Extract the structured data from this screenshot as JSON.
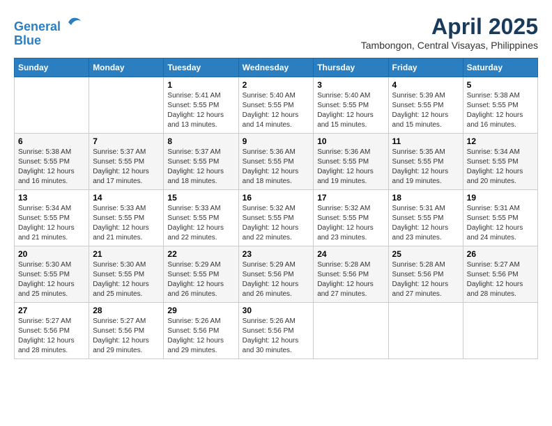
{
  "header": {
    "logo_line1": "General",
    "logo_line2": "Blue",
    "title": "April 2025",
    "subtitle": "Tambongon, Central Visayas, Philippines"
  },
  "weekdays": [
    "Sunday",
    "Monday",
    "Tuesday",
    "Wednesday",
    "Thursday",
    "Friday",
    "Saturday"
  ],
  "weeks": [
    [
      {
        "day": "",
        "info": ""
      },
      {
        "day": "",
        "info": ""
      },
      {
        "day": "1",
        "info": "Sunrise: 5:41 AM\nSunset: 5:55 PM\nDaylight: 12 hours\nand 13 minutes."
      },
      {
        "day": "2",
        "info": "Sunrise: 5:40 AM\nSunset: 5:55 PM\nDaylight: 12 hours\nand 14 minutes."
      },
      {
        "day": "3",
        "info": "Sunrise: 5:40 AM\nSunset: 5:55 PM\nDaylight: 12 hours\nand 15 minutes."
      },
      {
        "day": "4",
        "info": "Sunrise: 5:39 AM\nSunset: 5:55 PM\nDaylight: 12 hours\nand 15 minutes."
      },
      {
        "day": "5",
        "info": "Sunrise: 5:38 AM\nSunset: 5:55 PM\nDaylight: 12 hours\nand 16 minutes."
      }
    ],
    [
      {
        "day": "6",
        "info": "Sunrise: 5:38 AM\nSunset: 5:55 PM\nDaylight: 12 hours\nand 16 minutes."
      },
      {
        "day": "7",
        "info": "Sunrise: 5:37 AM\nSunset: 5:55 PM\nDaylight: 12 hours\nand 17 minutes."
      },
      {
        "day": "8",
        "info": "Sunrise: 5:37 AM\nSunset: 5:55 PM\nDaylight: 12 hours\nand 18 minutes."
      },
      {
        "day": "9",
        "info": "Sunrise: 5:36 AM\nSunset: 5:55 PM\nDaylight: 12 hours\nand 18 minutes."
      },
      {
        "day": "10",
        "info": "Sunrise: 5:36 AM\nSunset: 5:55 PM\nDaylight: 12 hours\nand 19 minutes."
      },
      {
        "day": "11",
        "info": "Sunrise: 5:35 AM\nSunset: 5:55 PM\nDaylight: 12 hours\nand 19 minutes."
      },
      {
        "day": "12",
        "info": "Sunrise: 5:34 AM\nSunset: 5:55 PM\nDaylight: 12 hours\nand 20 minutes."
      }
    ],
    [
      {
        "day": "13",
        "info": "Sunrise: 5:34 AM\nSunset: 5:55 PM\nDaylight: 12 hours\nand 21 minutes."
      },
      {
        "day": "14",
        "info": "Sunrise: 5:33 AM\nSunset: 5:55 PM\nDaylight: 12 hours\nand 21 minutes."
      },
      {
        "day": "15",
        "info": "Sunrise: 5:33 AM\nSunset: 5:55 PM\nDaylight: 12 hours\nand 22 minutes."
      },
      {
        "day": "16",
        "info": "Sunrise: 5:32 AM\nSunset: 5:55 PM\nDaylight: 12 hours\nand 22 minutes."
      },
      {
        "day": "17",
        "info": "Sunrise: 5:32 AM\nSunset: 5:55 PM\nDaylight: 12 hours\nand 23 minutes."
      },
      {
        "day": "18",
        "info": "Sunrise: 5:31 AM\nSunset: 5:55 PM\nDaylight: 12 hours\nand 23 minutes."
      },
      {
        "day": "19",
        "info": "Sunrise: 5:31 AM\nSunset: 5:55 PM\nDaylight: 12 hours\nand 24 minutes."
      }
    ],
    [
      {
        "day": "20",
        "info": "Sunrise: 5:30 AM\nSunset: 5:55 PM\nDaylight: 12 hours\nand 25 minutes."
      },
      {
        "day": "21",
        "info": "Sunrise: 5:30 AM\nSunset: 5:55 PM\nDaylight: 12 hours\nand 25 minutes."
      },
      {
        "day": "22",
        "info": "Sunrise: 5:29 AM\nSunset: 5:55 PM\nDaylight: 12 hours\nand 26 minutes."
      },
      {
        "day": "23",
        "info": "Sunrise: 5:29 AM\nSunset: 5:56 PM\nDaylight: 12 hours\nand 26 minutes."
      },
      {
        "day": "24",
        "info": "Sunrise: 5:28 AM\nSunset: 5:56 PM\nDaylight: 12 hours\nand 27 minutes."
      },
      {
        "day": "25",
        "info": "Sunrise: 5:28 AM\nSunset: 5:56 PM\nDaylight: 12 hours\nand 27 minutes."
      },
      {
        "day": "26",
        "info": "Sunrise: 5:27 AM\nSunset: 5:56 PM\nDaylight: 12 hours\nand 28 minutes."
      }
    ],
    [
      {
        "day": "27",
        "info": "Sunrise: 5:27 AM\nSunset: 5:56 PM\nDaylight: 12 hours\nand 28 minutes."
      },
      {
        "day": "28",
        "info": "Sunrise: 5:27 AM\nSunset: 5:56 PM\nDaylight: 12 hours\nand 29 minutes."
      },
      {
        "day": "29",
        "info": "Sunrise: 5:26 AM\nSunset: 5:56 PM\nDaylight: 12 hours\nand 29 minutes."
      },
      {
        "day": "30",
        "info": "Sunrise: 5:26 AM\nSunset: 5:56 PM\nDaylight: 12 hours\nand 30 minutes."
      },
      {
        "day": "",
        "info": ""
      },
      {
        "day": "",
        "info": ""
      },
      {
        "day": "",
        "info": ""
      }
    ]
  ]
}
